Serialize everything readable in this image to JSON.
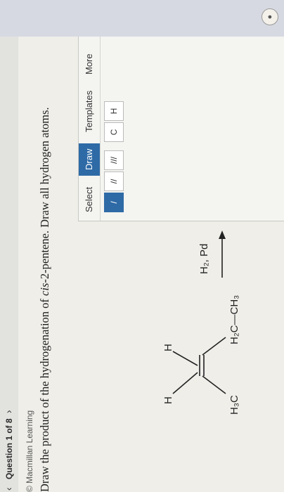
{
  "question": {
    "title": "Question 1 of 8",
    "prev_icon": "chevron-left-icon",
    "next_icon": "chevron-right-icon"
  },
  "brand": "© Macmillan Learning",
  "prompt": {
    "before": "Draw the product of the hydrogenation of ",
    "emph": "cis",
    "after": "-2-pentene. Draw all hydrogen atoms."
  },
  "molecule": {
    "h_left": "H",
    "h_right": "H",
    "methyl": "H₃C",
    "ethyl": "H₂C—CH₃"
  },
  "reagent": "H₂, Pd",
  "editor": {
    "tabs": [
      "Select",
      "Draw",
      "Templates",
      "More"
    ],
    "active_tab": "Draw",
    "bond_tools": [
      "/",
      "//",
      "///"
    ],
    "atoms": [
      "C",
      "H"
    ]
  },
  "colors": {
    "accent": "#2e6aa6"
  }
}
